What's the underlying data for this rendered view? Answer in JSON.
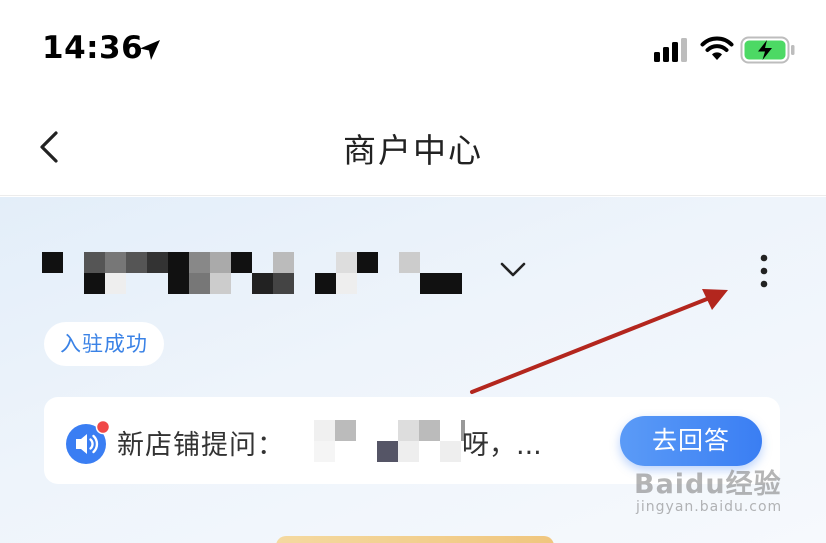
{
  "status_bar": {
    "time": "14:36",
    "icons": [
      "location-arrow-icon",
      "signal-icon",
      "wifi-icon",
      "battery-charging-icon"
    ],
    "battery_color": "#4cd964"
  },
  "nav": {
    "title": "商户中心",
    "back_icon": "chevron-left-icon"
  },
  "merchant": {
    "store_name_redacted": true,
    "status_badge": "入驻成功",
    "more_icon": "more-vertical-icon",
    "dropdown_icon": "chevron-down-icon"
  },
  "question": {
    "label": "新店铺提问：",
    "tail": "呀，...",
    "answer_button": "去回答",
    "has_unread_dot": true
  },
  "annotation": {
    "arrow_color": "#b3261e"
  },
  "watermark": {
    "main": "Baidu经验",
    "sub": "jingyan.baidu.com"
  },
  "colors": {
    "accent": "#3a7ef3",
    "badge_text": "#3a82e6",
    "unread_dot": "#f04848"
  }
}
